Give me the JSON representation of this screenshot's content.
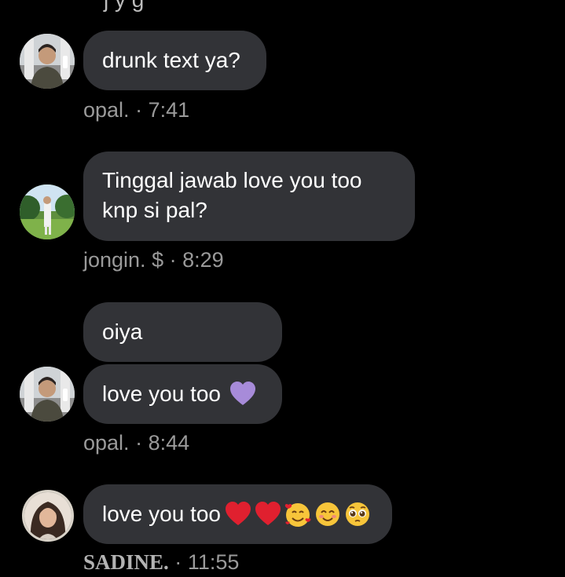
{
  "messages": [
    {
      "lines": [
        "drunk text ya?"
      ],
      "meta": {
        "name": "opal.",
        "separator": "·",
        "time": "7:41"
      }
    },
    {
      "lines": [
        "Tinggal jawab love you too",
        "knp si pal?"
      ],
      "meta": {
        "name": "jongin. $",
        "separator": "·",
        "time": "8:29"
      }
    },
    {
      "lines": [
        "oiya"
      ]
    },
    {
      "lines": [
        "love you too"
      ],
      "emoji": [
        "purple-heart-icon"
      ],
      "meta": {
        "name": "opal.",
        "separator": "·",
        "time": "8:44"
      }
    },
    {
      "lines": [
        "love you too"
      ],
      "emoji": [
        "red-heart-icon",
        "red-heart-icon",
        "smiling-face-with-hearts-icon",
        "smiling-face-with-smiling-eyes-icon",
        "pleading-face-icon"
      ],
      "meta": {
        "name": "SADINE.",
        "separator": "·",
        "time": "11:55"
      }
    }
  ],
  "colors": {
    "background": "#000000",
    "bubble": "#323337",
    "meta_text": "#9a9a9a",
    "purple_heart": "#a78bd9",
    "red_heart": "#e0202f"
  }
}
